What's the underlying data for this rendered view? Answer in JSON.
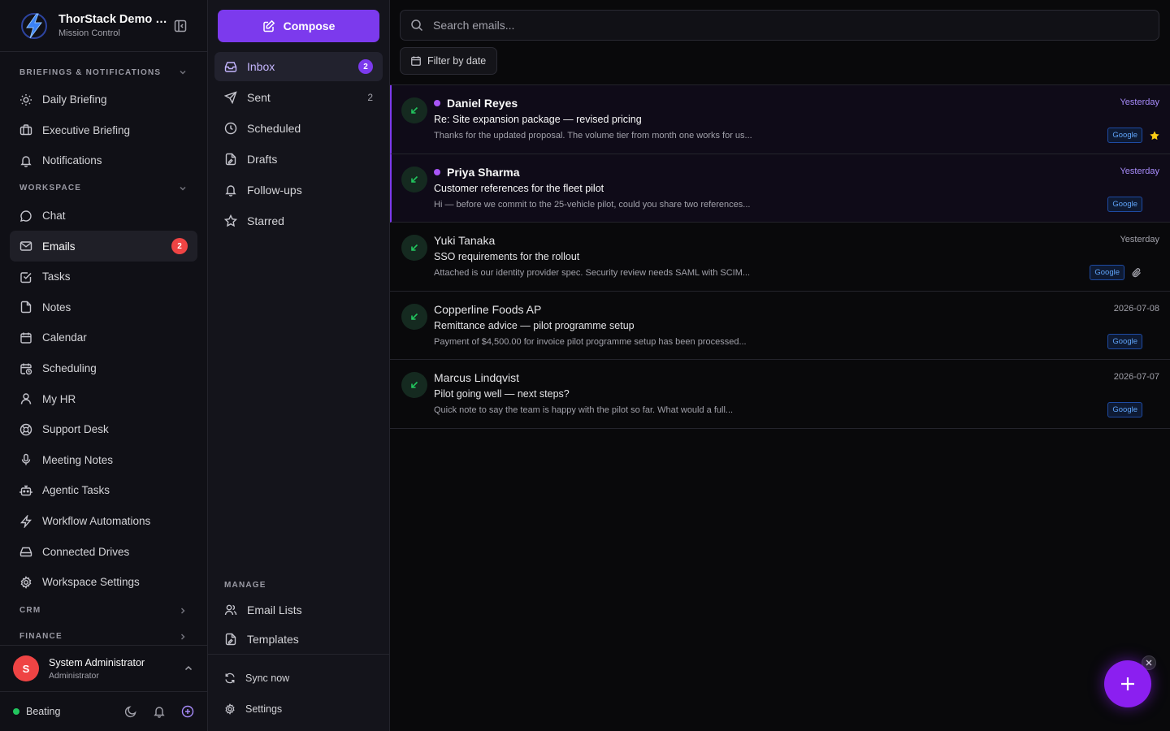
{
  "app": {
    "title": "ThorStack Demo Company",
    "subtitle": "Mission Control",
    "brand_color": "#7c3aed"
  },
  "sidebar": {
    "section_briefings": "BRIEFINGS & NOTIFICATIONS",
    "briefing_items": [
      {
        "label": "Daily Briefing",
        "icon": "sun-icon"
      },
      {
        "label": "Executive Briefing",
        "icon": "briefcase-icon"
      },
      {
        "label": "Notifications",
        "icon": "bell-icon"
      }
    ],
    "section_workspace": "WORKSPACE",
    "workspace_items": [
      {
        "label": "Chat",
        "icon": "chat-bubble-icon"
      },
      {
        "label": "Emails",
        "icon": "mail-icon",
        "badge": "2",
        "active": true
      },
      {
        "label": "Tasks",
        "icon": "checkbox-icon"
      },
      {
        "label": "Notes",
        "icon": "file-icon"
      },
      {
        "label": "Calendar",
        "icon": "calendar-icon"
      },
      {
        "label": "Scheduling",
        "icon": "calendar-clock-icon"
      },
      {
        "label": "My HR",
        "icon": "user-icon"
      },
      {
        "label": "Support Desk",
        "icon": "lifebuoy-icon"
      },
      {
        "label": "Meeting Notes",
        "icon": "microphone-icon"
      },
      {
        "label": "Agentic Tasks",
        "icon": "robot-icon"
      },
      {
        "label": "Workflow Automations",
        "icon": "lightning-icon"
      },
      {
        "label": "Connected Drives",
        "icon": "hard-drive-icon"
      },
      {
        "label": "Workspace Settings",
        "icon": "gear-icon"
      }
    ],
    "section_crm": "CRM",
    "section_finance": "FINANCE",
    "user": {
      "initial": "S",
      "name": "System Administrator",
      "role": "Administrator"
    },
    "status": "Beating"
  },
  "folders": {
    "compose_label": "Compose",
    "items": [
      {
        "label": "Inbox",
        "badge": "2",
        "icon": "inbox-icon",
        "active": true
      },
      {
        "label": "Sent",
        "count": "2",
        "icon": "send-icon"
      },
      {
        "label": "Scheduled",
        "icon": "clock-icon"
      },
      {
        "label": "Drafts",
        "icon": "draft-file-icon"
      },
      {
        "label": "Follow-ups",
        "icon": "bell-icon"
      },
      {
        "label": "Starred",
        "icon": "star-icon"
      }
    ],
    "manage_header": "MANAGE",
    "manage_items": [
      {
        "label": "Email Lists",
        "icon": "users-icon"
      },
      {
        "label": "Templates",
        "icon": "template-file-icon"
      }
    ],
    "footer_items": [
      {
        "label": "Sync now",
        "icon": "refresh-icon"
      },
      {
        "label": "Settings",
        "icon": "gear-icon"
      }
    ]
  },
  "main": {
    "search_placeholder": "Search emails...",
    "filter_label": "Filter by date",
    "emails": [
      {
        "sender": "Daniel Reyes",
        "subject": "Re: Site expansion package — revised pricing",
        "preview": "Thanks for the updated proposal. The volume tier from month one works for us...",
        "date": "Yesterday",
        "tag": "Google",
        "unread": true,
        "starred": true,
        "attachment": false
      },
      {
        "sender": "Priya Sharma",
        "subject": "Customer references for the fleet pilot",
        "preview": "Hi — before we commit to the 25-vehicle pilot, could you share two references...",
        "date": "Yesterday",
        "tag": "Google",
        "unread": true,
        "starred": false,
        "attachment": false
      },
      {
        "sender": "Yuki Tanaka",
        "subject": "SSO requirements for the rollout",
        "preview": "Attached is our identity provider spec. Security review needs SAML with SCIM...",
        "date": "Yesterday",
        "tag": "Google",
        "unread": false,
        "starred": false,
        "attachment": true
      },
      {
        "sender": "Copperline Foods AP",
        "subject": "Remittance advice — pilot programme setup",
        "preview": "Payment of $4,500.00 for invoice pilot programme setup has been processed...",
        "date": "2026-07-08",
        "tag": "Google",
        "unread": false,
        "starred": false,
        "attachment": false
      },
      {
        "sender": "Marcus Lindqvist",
        "subject": "Pilot going well — next steps?",
        "preview": "Quick note to say the team is happy with the pilot so far. What would a full...",
        "date": "2026-07-07",
        "tag": "Google",
        "unread": false,
        "starred": false,
        "attachment": false
      }
    ]
  }
}
